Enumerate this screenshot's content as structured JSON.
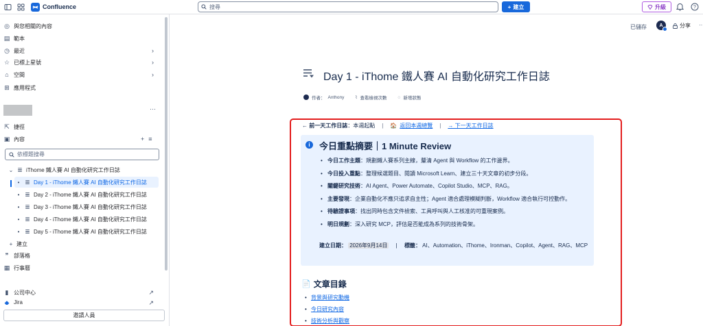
{
  "topbar": {
    "app_name": "Confluence",
    "search_placeholder": "搜尋",
    "create_label": "建立",
    "upgrade_label": "升級"
  },
  "sidebar": {
    "nav": [
      {
        "label": "與您相關的內容",
        "icon": "user-circle-icon"
      },
      {
        "label": "範本",
        "icon": "template-icon"
      },
      {
        "label": "最近",
        "icon": "clock-icon"
      },
      {
        "label": "已標上星號",
        "icon": "star-icon"
      },
      {
        "label": "空間",
        "icon": "space-icon"
      },
      {
        "label": "應用程式",
        "icon": "apps-icon"
      }
    ],
    "shortcuts_label": "捷徑",
    "content_label": "內容",
    "tree_search_placeholder": "依標題搜尋",
    "tree": [
      {
        "label": "iThome 鐵人賽 AI 自動化研究工作日誌"
      },
      {
        "label": "Day 1 - iThome 鐵人賽 AI 自動化研究工作日誌"
      },
      {
        "label": "Day 2 - iThome 鐵人賽 AI 自動化研究工作日誌"
      },
      {
        "label": "Day 3 - iThome 鐵人賽 AI 自動化研究工作日誌"
      },
      {
        "label": "Day 4 - iThome 鐵人賽 AI 自動化研究工作日誌"
      },
      {
        "label": "Day 5 - iThome 鐵人賽 AI 自動化研究工作日誌"
      }
    ],
    "tree_create_label": "建立",
    "blog_label": "部落格",
    "calendar_label": "行事曆",
    "company_hub_label": "公司中心",
    "jira_label": "Jira",
    "invite_label": "邀請人員"
  },
  "header": {
    "saved_label": "已儲存",
    "avatar_initial": "A",
    "share_label": "分享"
  },
  "page": {
    "title": "Day 1 - iThome 鐵人賽 AI 自動化研究工作日誌",
    "author_prefix": "作者：",
    "author": "Anthony",
    "view_count_label": "查看檢視次數",
    "add_status_label": "新增狀態",
    "nav": {
      "prev_label": "← 前一天工作日誌",
      "prev_value": "：本週起點",
      "home_link": "返回本週總覽",
      "next_link": "→ 下一天工作日誌"
    },
    "summary": {
      "title": "今日重點摘要｜1 Minute Review",
      "items": [
        {
          "key": "今日工作主題",
          "text": "：規劃鐵人賽系列主線，釐清 Agent 與 Workflow 的工作邊界。"
        },
        {
          "key": "今日投入重點",
          "text": "：整理候選題目、閱讀 Microsoft Learn、建立三十天文章的初步分段。"
        },
        {
          "key": "關鍵研究技術",
          "text": "：AI Agent、Power Automate、Copilot Studio、MCP、RAG。"
        },
        {
          "key": "主要發現",
          "text": "：企業自動化不應只追求自主性；Agent 適合處理模糊判斷，Workflow 適合執行可控動作。"
        },
        {
          "key": "待驗證事項",
          "text": "：找出同時包含文件檢索、工具呼叫與人工核准的可重現案例。"
        },
        {
          "key": "明日規劃",
          "text": "：深入研究 MCP，評估是否能成為系列的技術骨架。"
        }
      ],
      "created_key": "建立日期",
      "created_value": "2026年9月14日",
      "tags_key": "標籤",
      "tags_value": "AI、Automation、iThome、Ironman、Copilot、Agent、RAG、MCP"
    },
    "toc": {
      "title": "文章目錄",
      "items": [
        "背景與研究動機",
        "今日研究內容",
        "技術分析與觀察"
      ]
    }
  },
  "colors": {
    "brand": "#1868db",
    "highlight_frame": "#e31b1b",
    "info_panel": "#e9f2ff",
    "upgrade": "#8f43c8"
  }
}
